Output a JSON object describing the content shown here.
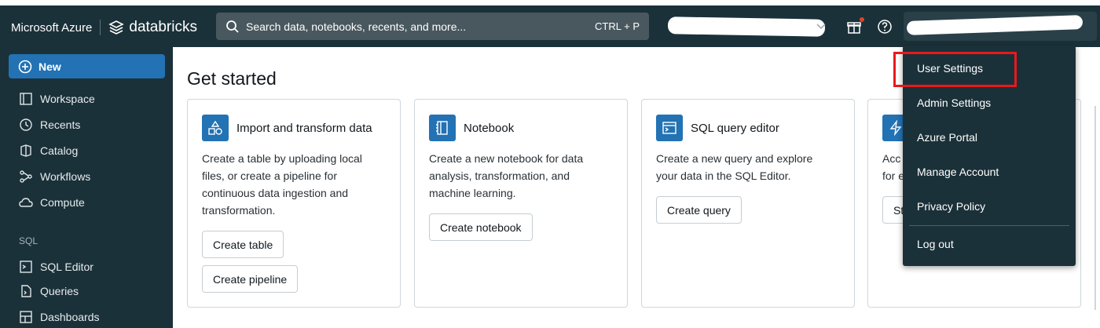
{
  "header": {
    "brand_azure": "Microsoft Azure",
    "brand_databricks": "databricks",
    "search_placeholder": "Search data, notebooks, recents, and more...",
    "search_shortcut": "CTRL + P"
  },
  "sidebar": {
    "new_label": "New",
    "items": [
      {
        "label": "Workspace",
        "icon": "workspace-icon"
      },
      {
        "label": "Recents",
        "icon": "clock-icon"
      },
      {
        "label": "Catalog",
        "icon": "catalog-icon"
      },
      {
        "label": "Workflows",
        "icon": "workflows-icon"
      },
      {
        "label": "Compute",
        "icon": "cloud-icon"
      }
    ],
    "section_sql": "SQL",
    "sql_items": [
      {
        "label": "SQL Editor",
        "icon": "sql-editor-icon"
      },
      {
        "label": "Queries",
        "icon": "queries-icon"
      },
      {
        "label": "Dashboards",
        "icon": "dashboards-icon"
      }
    ]
  },
  "main": {
    "title": "Get started",
    "cards": [
      {
        "title": "Import and transform data",
        "icon": "shapes-icon",
        "description": "Create a table by uploading local files, or create a pipeline for continuous data ingestion and transformation.",
        "buttons": [
          "Create table",
          "Create pipeline"
        ]
      },
      {
        "title": "Notebook",
        "icon": "notebook-icon",
        "description": "Create a new notebook for data analysis, transformation, and machine learning.",
        "buttons": [
          "Create notebook"
        ]
      },
      {
        "title": "SQL query editor",
        "icon": "sql-editor-icon",
        "description": "Create a new query and explore your data in the SQL Editor.",
        "buttons": [
          "Create query"
        ]
      },
      {
        "title": "",
        "icon": "lightning-icon",
        "description_lines": [
          "Acc",
          "for e"
        ],
        "button": "St"
      }
    ]
  },
  "user_menu": {
    "items": [
      "User Settings",
      "Admin Settings",
      "Azure Portal",
      "Manage Account",
      "Privacy Policy"
    ],
    "logout": "Log out"
  },
  "colors": {
    "nav_bg": "#1b3139",
    "accent": "#2272b4",
    "highlight": "#e8191c"
  }
}
